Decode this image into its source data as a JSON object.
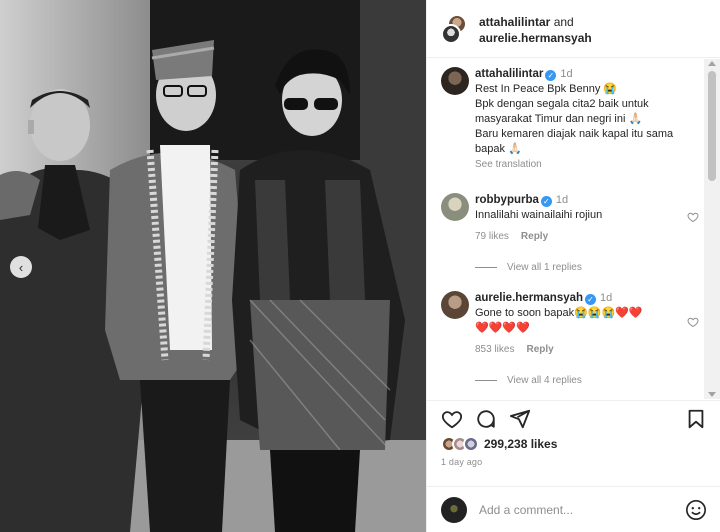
{
  "header": {
    "user1": "attahalilintar",
    "and": "and",
    "user2": "aurelie.hermansyah"
  },
  "comments": [
    {
      "username": "attahalilintar",
      "time": "1d",
      "lines": [
        "Rest In Peace Bpk Benny 😭",
        "Bpk dengan segala cita2 baik untuk masyarakat Timur dan negri ini 🙏🏻",
        "Baru kemaren diajak naik kapal itu sama bapak 🙏🏻"
      ],
      "see_translation": "See translation"
    },
    {
      "username": "robbypurba",
      "time": "1d",
      "text": "Innalilahi wainailaihi rojiun",
      "likes": "79 likes",
      "reply": "Reply",
      "view_replies": "View all 1 replies"
    },
    {
      "username": "aurelie.hermansyah",
      "time": "1d",
      "text": "Gone to soon bapak😭😭😭❤️❤️",
      "text2": "❤️❤️❤️❤️",
      "likes": "853 likes",
      "reply": "Reply",
      "view_replies": "View all 4 replies"
    }
  ],
  "icons": {
    "like": "heart-icon",
    "comment": "comment-icon",
    "share": "share-icon",
    "save": "bookmark-icon",
    "emoji": "emoji-icon",
    "prev": "chevron-left-icon"
  },
  "post": {
    "likes": "299,238 likes",
    "time_ago": "1 day ago"
  },
  "add_comment": {
    "placeholder": "Add a comment..."
  },
  "colors": {
    "verified": "#3897f0",
    "muted": "#8e8e8e",
    "text": "#262626"
  }
}
